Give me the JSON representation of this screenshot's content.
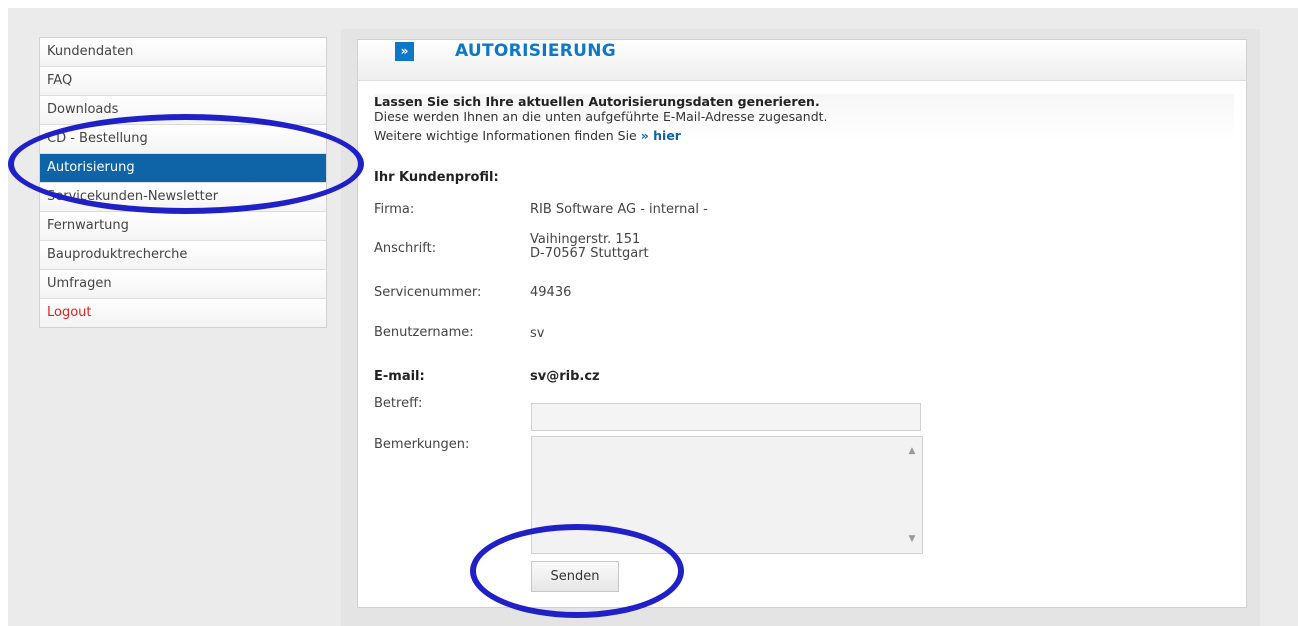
{
  "sidebar": {
    "items": [
      {
        "label": "Kundendaten"
      },
      {
        "label": "FAQ"
      },
      {
        "label": "Downloads"
      },
      {
        "label": "CD - Bestellung"
      },
      {
        "label": "Autorisierung",
        "active": true
      },
      {
        "label": "Servicekunden-Newsletter"
      },
      {
        "label": "Fernwartung"
      },
      {
        "label": "Bauproduktrecherche"
      },
      {
        "label": "Umfragen"
      },
      {
        "label": "Logout"
      }
    ]
  },
  "header": {
    "chevron": "»",
    "title": "AUTORISIERUNG"
  },
  "intro": {
    "line1": "Lassen Sie sich Ihre aktuellen Autorisierungsdaten generieren.",
    "line2": "Diese werden Ihnen an die unten aufgeführte E-Mail-Adresse zugesandt.",
    "line3": "Weitere wichtige Informationen finden Sie",
    "link": "» hier"
  },
  "profile": {
    "heading": "Ihr Kundenprofil:",
    "firma_label": "Firma:",
    "firma_value": "RIB Software AG - internal -",
    "anschrift_label": "Anschrift:",
    "anschrift_line1": "Vaihingerstr. 151",
    "anschrift_line2": "D-70567 Stuttgart",
    "servicenummer_label": "Servicenummer:",
    "servicenummer_value": "49436",
    "benutzername_label": "Benutzername:",
    "benutzername_value": "sv",
    "email_label": "E-mail:",
    "email_value": "sv@rib.cz"
  },
  "form": {
    "betreff_label": "Betreff:",
    "betreff_value": "",
    "bemerkungen_label": "Bemerkungen:",
    "bemerkungen_value": "",
    "send_label": "Senden"
  },
  "colors": {
    "accent": "#0e64a6",
    "annotation": "#1f20c8",
    "logout": "#e02020"
  }
}
